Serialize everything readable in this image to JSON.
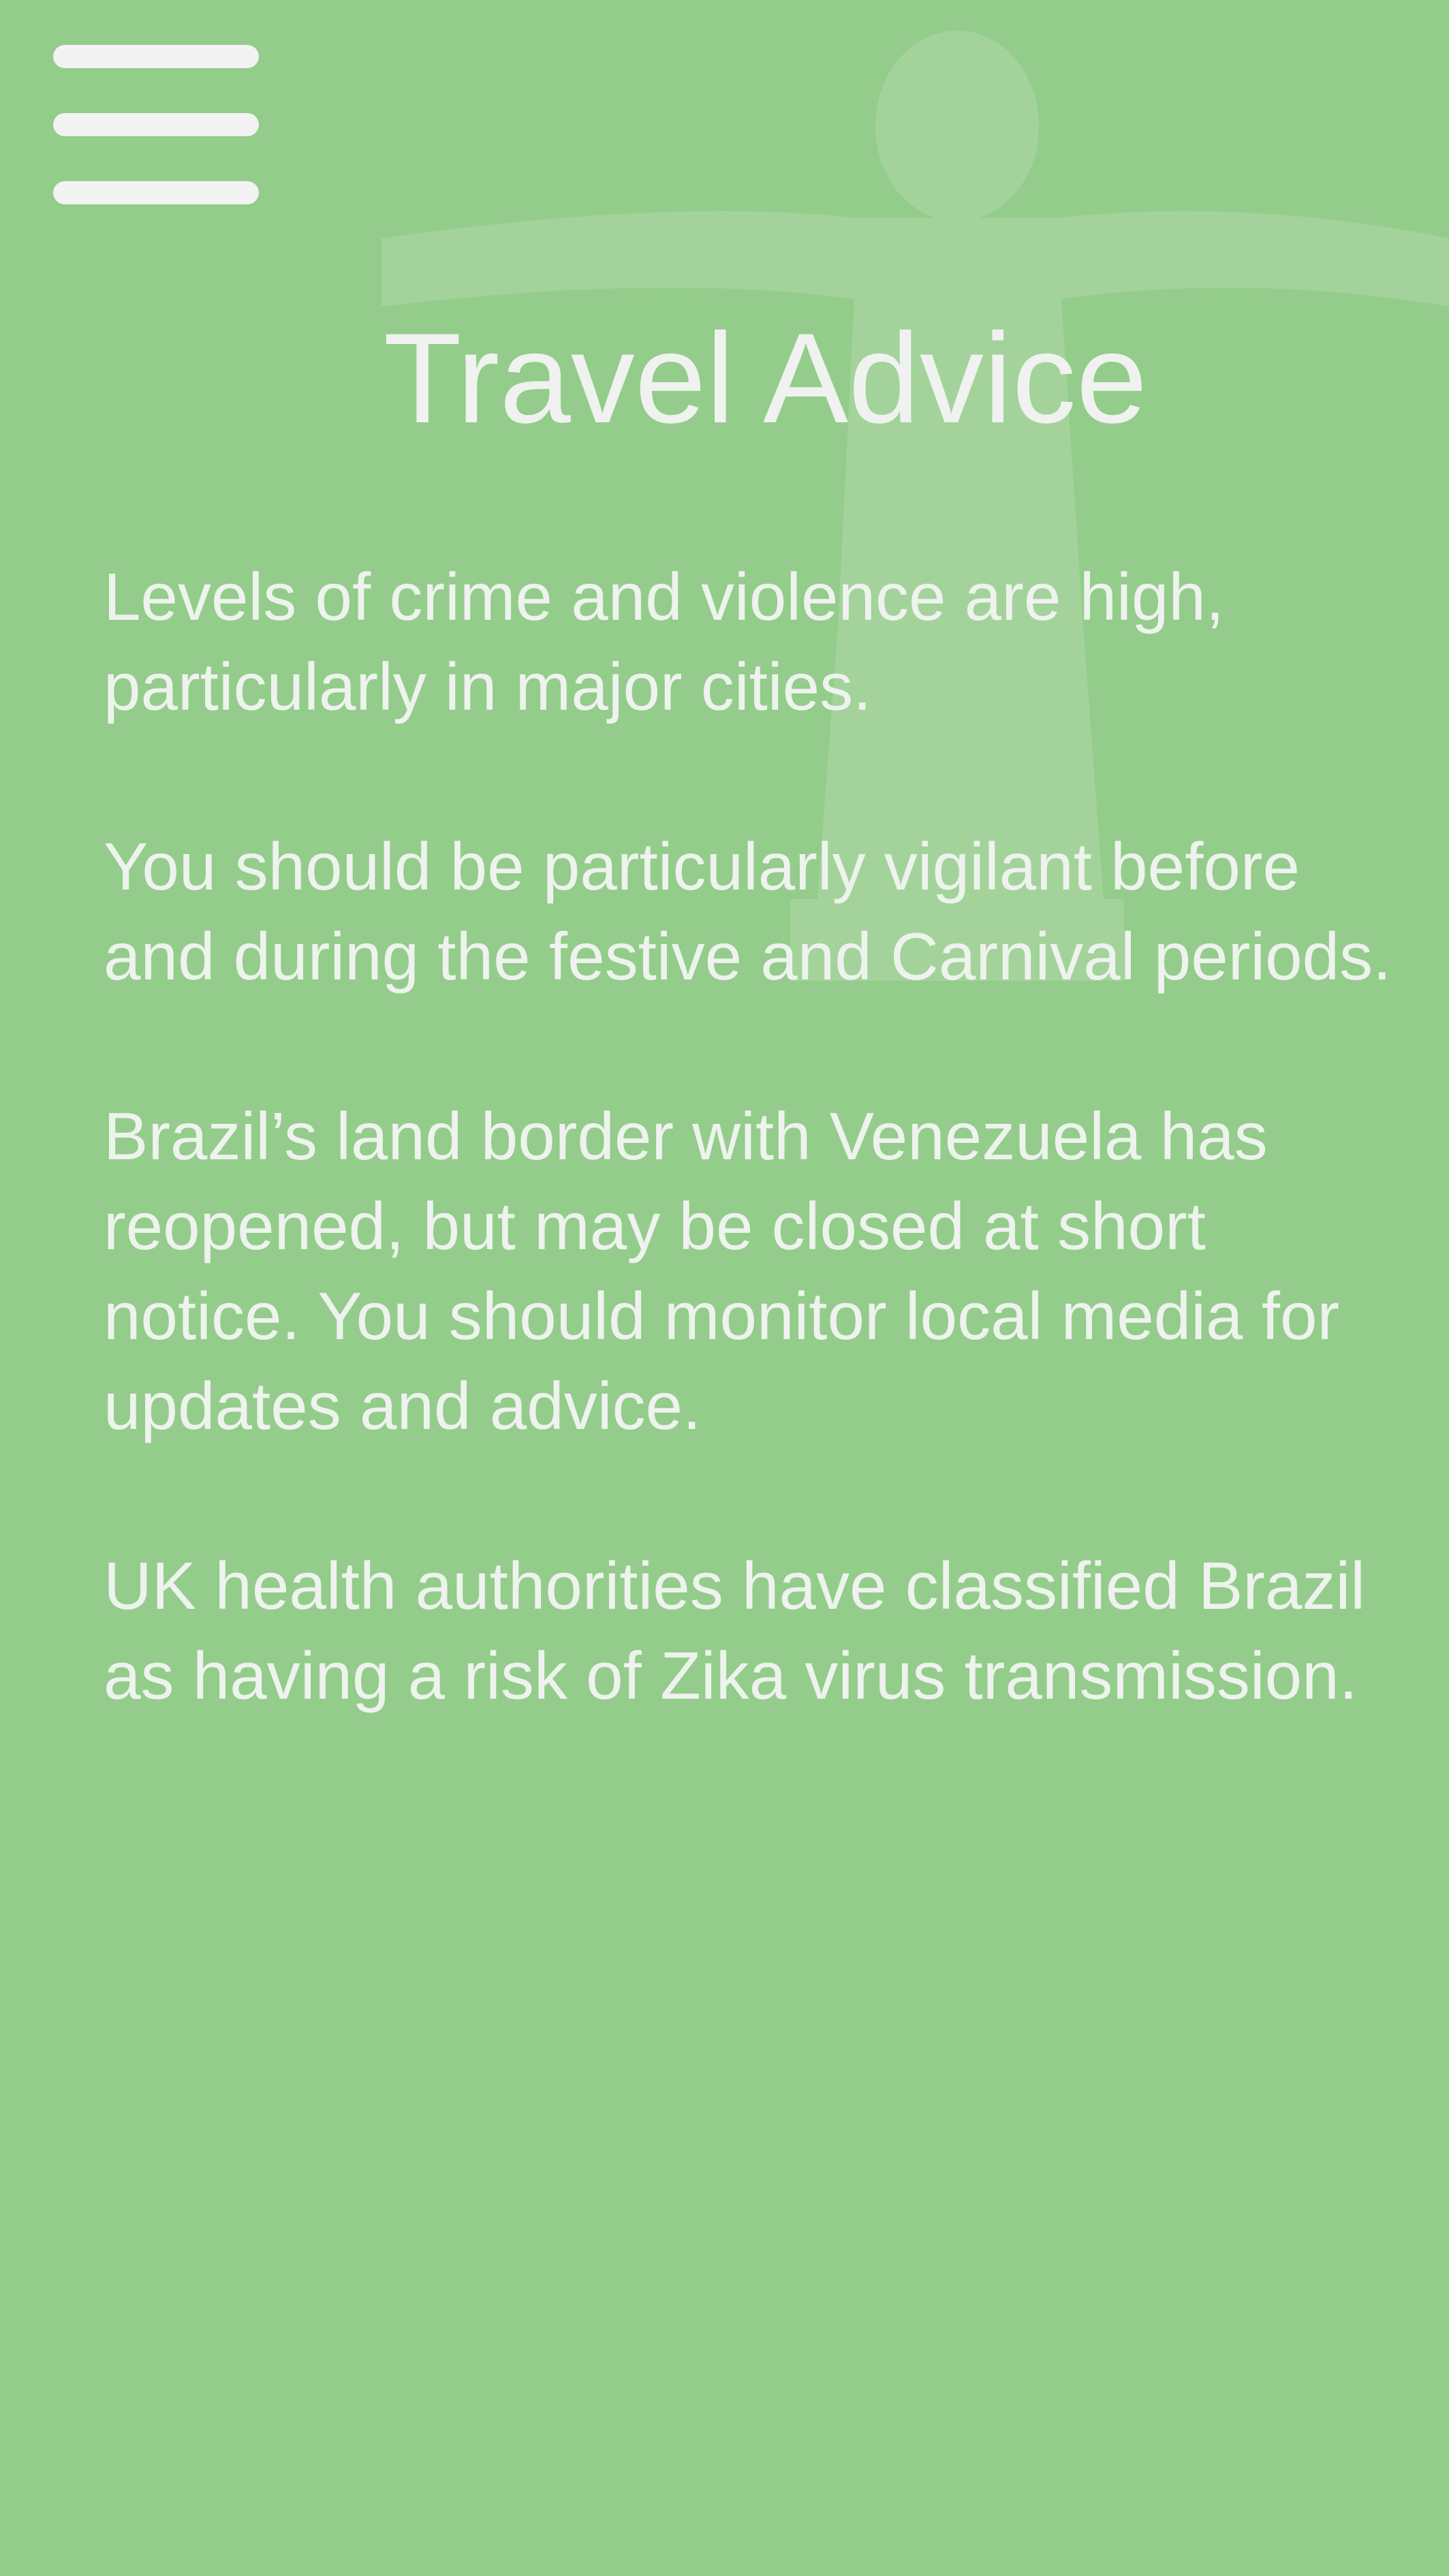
{
  "header": {
    "title": "Travel Advice"
  },
  "icons": {
    "menu": "hamburger-menu-icon",
    "background": "christ-the-redeemer-watermark"
  },
  "advice": [
    {
      "text": "Levels of crime and violence are high, particularly in major cities."
    },
    {
      "text": "You should be particularly vigilant before and during the festive and Carnival periods."
    },
    {
      "text": "Brazil’s land border with Venezuela has reopened, but may be closed at short notice. You should monitor local media for updates and advice."
    },
    {
      "text": "UK health authorities have classified Brazil as having a risk of Zika virus transmission."
    }
  ],
  "colors": {
    "background": "#94cc8b",
    "text": "#eef3ee",
    "menu_icon": "#f3f3f3"
  }
}
